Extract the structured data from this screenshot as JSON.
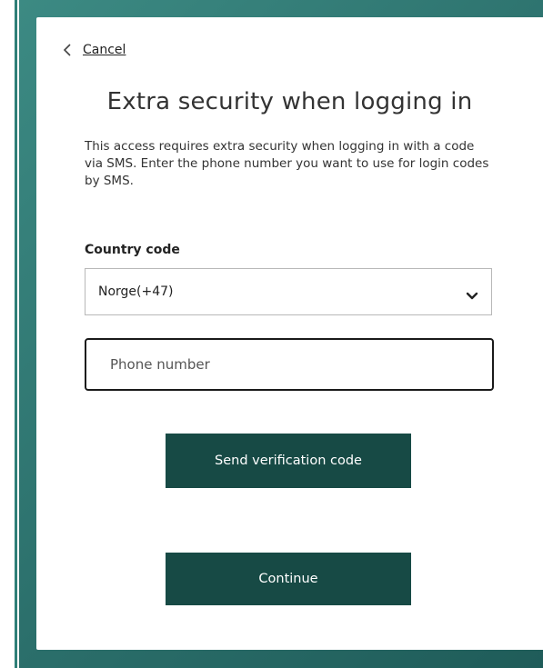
{
  "nav": {
    "cancel_label": "Cancel"
  },
  "page": {
    "title": "Extra security when logging in",
    "description": "This access requires extra security when logging in with a code via SMS. Enter the phone number you want to use for login codes by SMS."
  },
  "form": {
    "country_code_label": "Country code",
    "country_code_value": "Norge(+47)",
    "phone_placeholder": "Phone number",
    "phone_value": ""
  },
  "buttons": {
    "send_code_label": "Send verification code",
    "continue_label": "Continue"
  },
  "icons": {
    "back": "chevron-left-icon",
    "dropdown": "chevron-down-icon"
  },
  "colors": {
    "background_teal": "#2f7f78",
    "button_dark_green": "#174a45",
    "card_white": "#ffffff"
  }
}
